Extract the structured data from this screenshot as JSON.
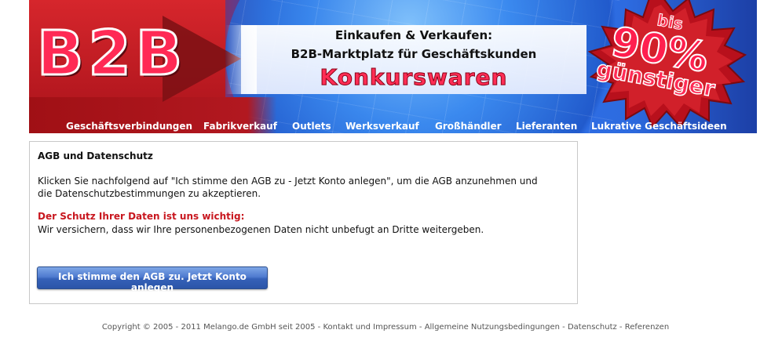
{
  "banner": {
    "logo": "B2B",
    "headline_line1": "Einkaufen & Verkaufen:",
    "headline_line2": "B2B-Marktplatz für Geschäftskunden",
    "headline_line3": "Konkurswaren",
    "promo_line1": "bis",
    "promo_line2": "90%",
    "promo_line3": "günstiger",
    "colors": {
      "red": "#c71c22",
      "blue": "#2f72ea",
      "pink": "#ff2a55"
    }
  },
  "nav": {
    "items": [
      {
        "label": "Geschäftsverbindungen"
      },
      {
        "label": "Fabrikverkauf"
      },
      {
        "label": "Outlets"
      },
      {
        "label": "Werksverkauf"
      },
      {
        "label": "Großhändler"
      },
      {
        "label": "Lieferanten"
      },
      {
        "label": "Lukrative Geschäftsideen"
      }
    ]
  },
  "content": {
    "title": "AGB und Datenschutz",
    "paragraph1": "Klicken Sie nachfolgend auf \"Ich stimme den AGB zu - Jetzt Konto anlegen\", um die AGB anzunehmen und die Datenschutzbestimmungen zu akzeptieren.",
    "warning": "Der Schutz Ihrer Daten ist uns wichtig:",
    "paragraph2": "Wir versichern, dass wir Ihre personenbezogenen Daten nicht unbefugt an Dritte weitergeben.",
    "button_label": "Ich stimme den AGB zu. Jetzt Konto anlegen"
  },
  "footer": {
    "copyright": "Copyright © 2005 - 2011 Melango.de GmbH seit 2005",
    "sep": " - ",
    "links": [
      "Kontakt und Impressum",
      "Allgemeine Nutzungsbedingungen",
      "Datenschutz",
      "Referenzen"
    ]
  }
}
